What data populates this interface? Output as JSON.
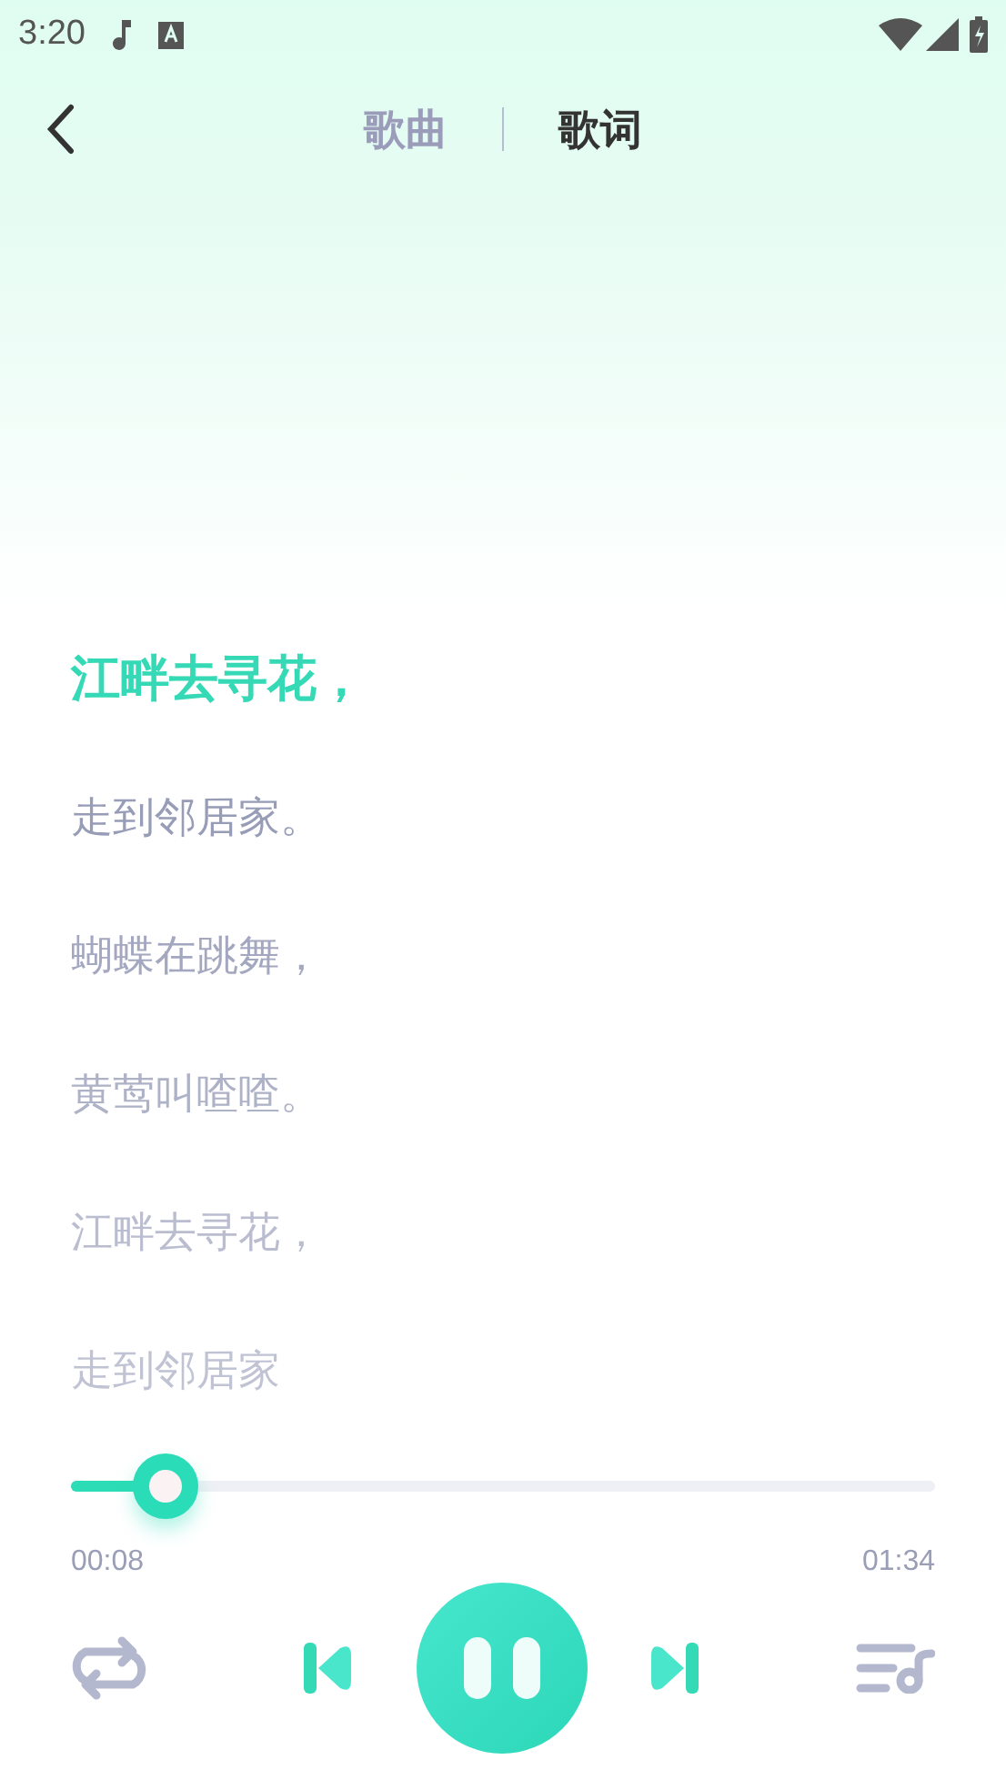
{
  "status_bar": {
    "time": "3:20"
  },
  "tabs": [
    {
      "label": "歌曲",
      "selected": false
    },
    {
      "label": "歌词",
      "selected": true
    }
  ],
  "lyrics": [
    {
      "text": "江畔去寻花，",
      "selected": true
    },
    {
      "text": "走到邻居家。",
      "selected": false
    },
    {
      "text": "蝴蝶在跳舞，",
      "selected": false
    },
    {
      "text": "黄莺叫喳喳。",
      "selected": false
    },
    {
      "text": "江畔去寻花，",
      "selected": false
    },
    {
      "text": "走到邻居家",
      "selected": false
    }
  ],
  "progress": {
    "level": 0.11,
    "elapsed": "00:08",
    "total": "01:34"
  },
  "player": {
    "playing": true
  }
}
